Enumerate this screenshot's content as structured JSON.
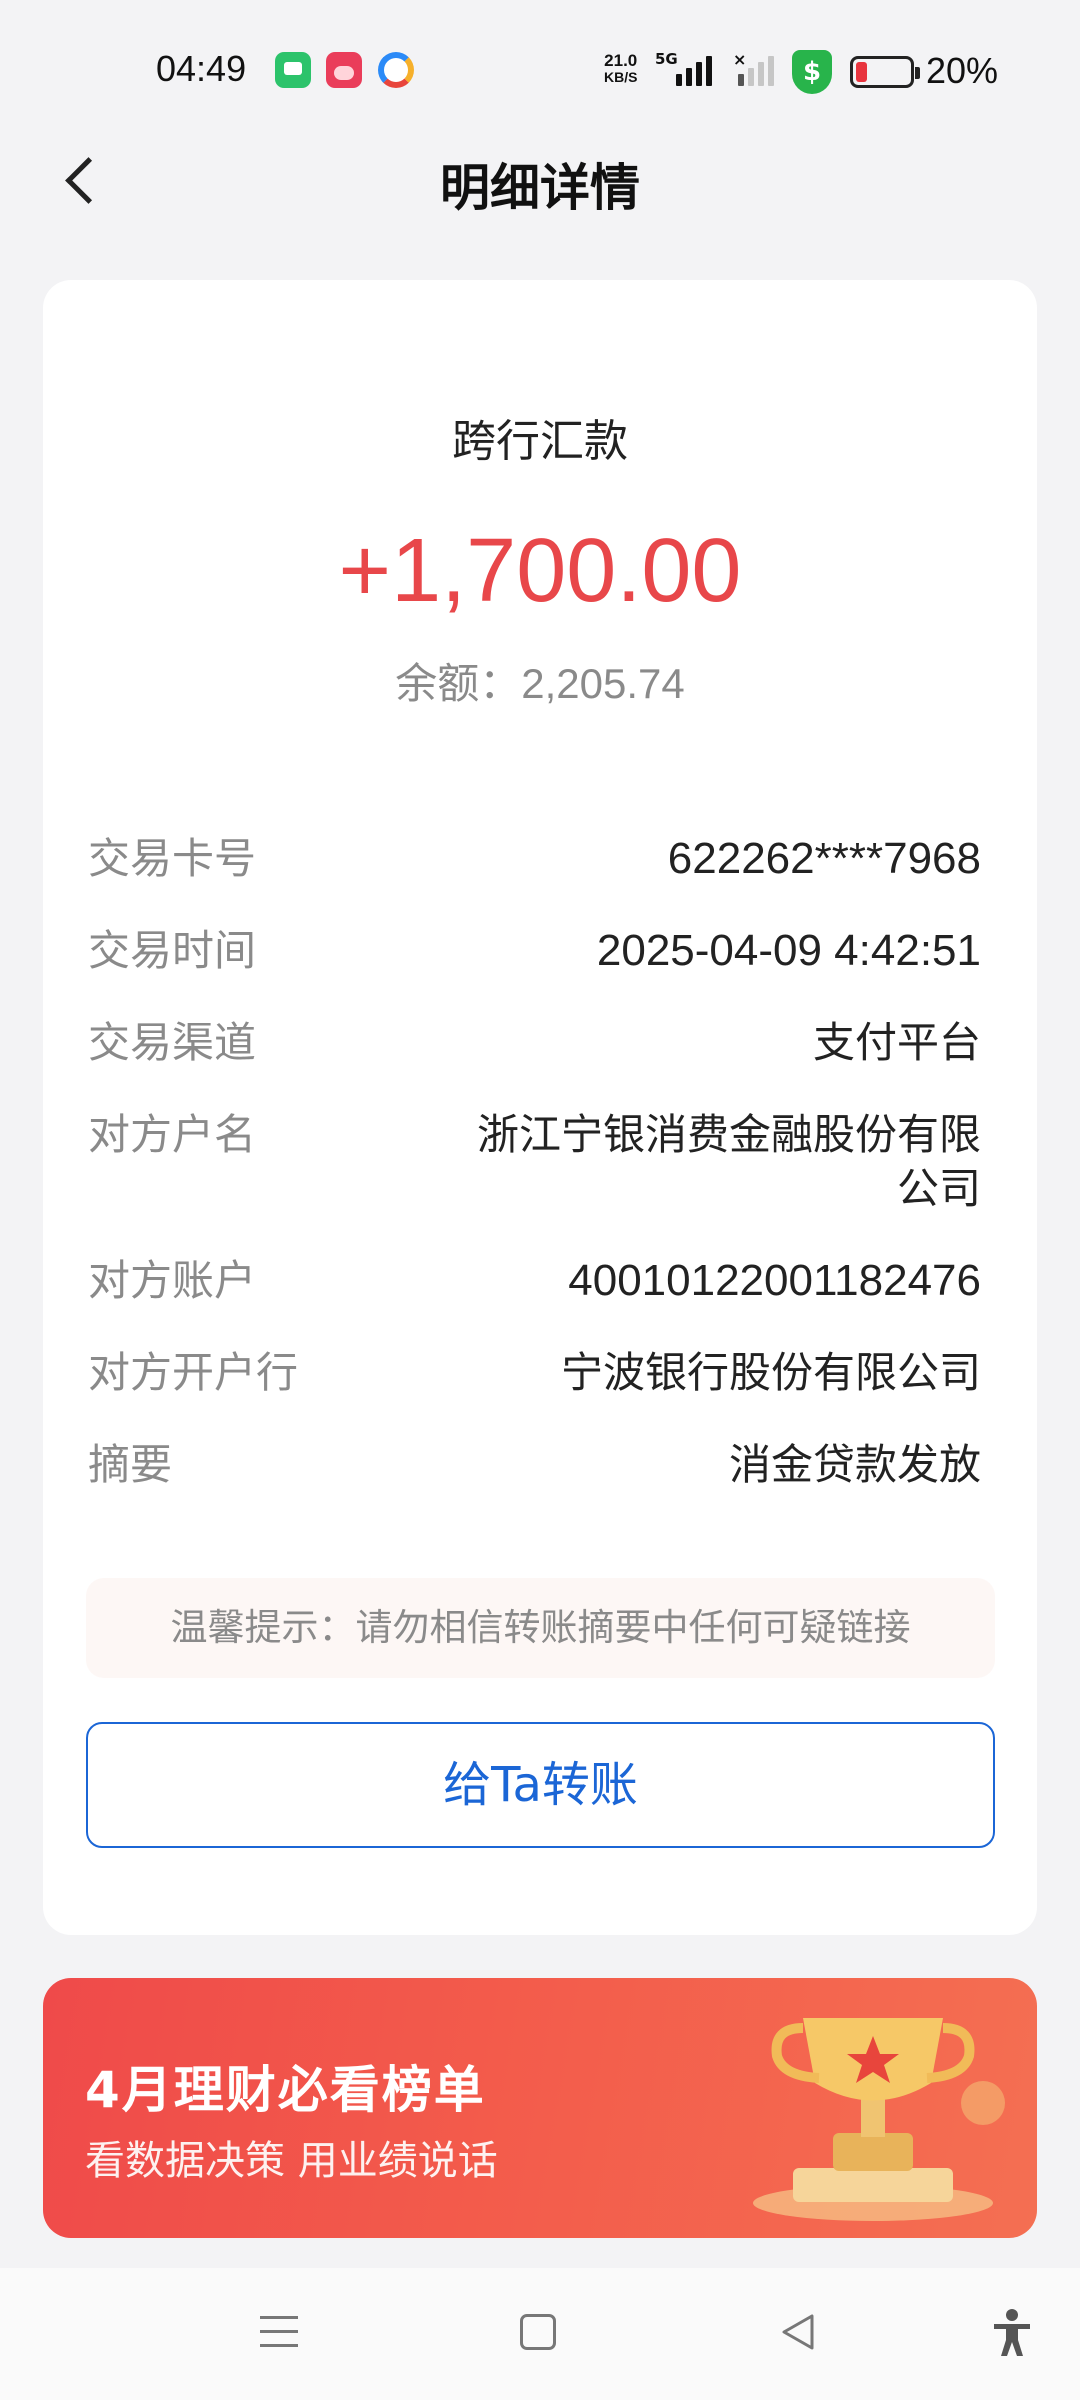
{
  "status_bar": {
    "time": "04:49",
    "net_speed_value": "21.0",
    "net_speed_unit": "KB/S",
    "network_type": "5G",
    "battery": "20%"
  },
  "header": {
    "title": "明细详情"
  },
  "transaction": {
    "type": "跨行汇款",
    "amount": "+1,700.00",
    "balance_label": "余额：",
    "balance_value": "2,205.74",
    "details": [
      {
        "label": "交易卡号",
        "value": "622262****7968"
      },
      {
        "label": "交易时间",
        "value": "2025-04-09 4:42:51"
      },
      {
        "label": "交易渠道",
        "value": "支付平台"
      },
      {
        "label": "对方户名",
        "value": "浙江宁银消费金融股份有限公司"
      },
      {
        "label": "对方账户",
        "value": "40010122001182476"
      },
      {
        "label": "对方开户行",
        "value": "宁波银行股份有限公司"
      },
      {
        "label": "摘要",
        "value": "消金贷款发放"
      }
    ],
    "tip": "温馨提示：请勿相信转账摘要中任何可疑链接",
    "transfer_button": "给Ta转账"
  },
  "banner": {
    "title": "4月理财必看榜单",
    "subtitle": "看数据决策 用业绩说话"
  },
  "colors": {
    "amount": "#e8474a",
    "accent": "#1b66d6",
    "banner": "#ef4a4a"
  }
}
